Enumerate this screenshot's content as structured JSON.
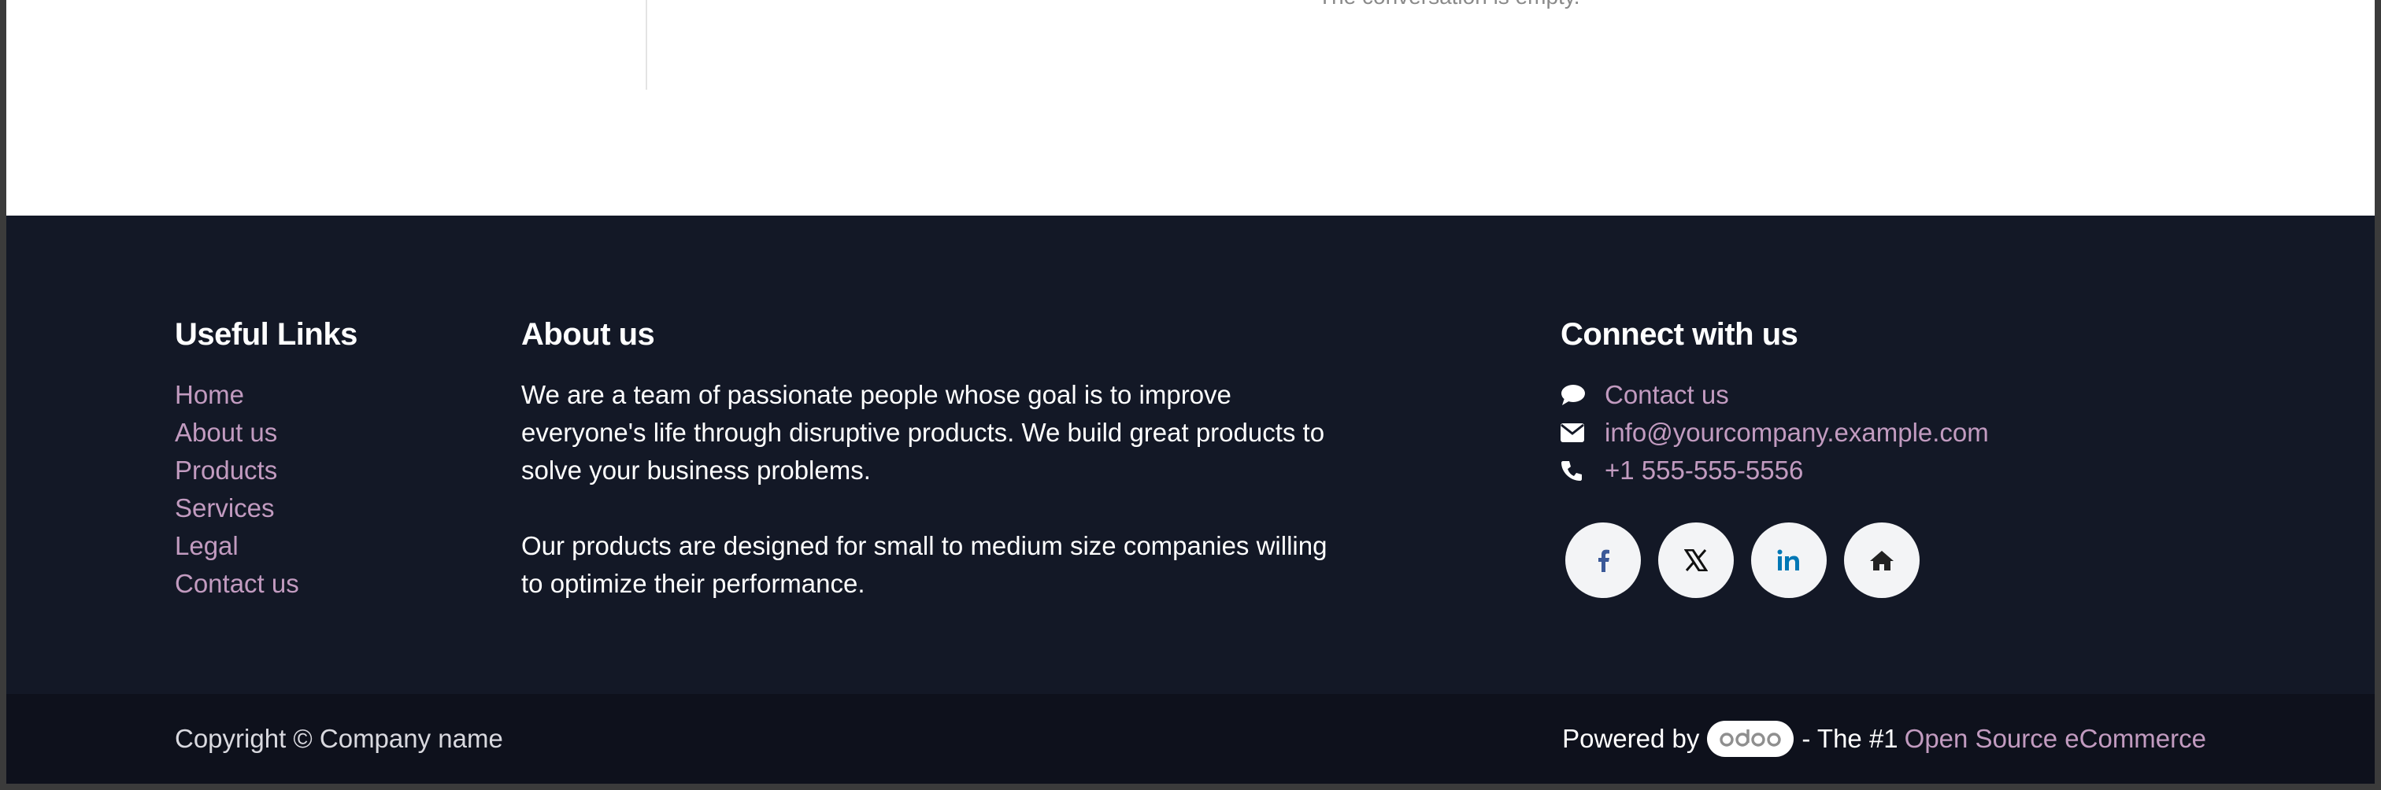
{
  "chat": {
    "empty_message": "The conversation is empty."
  },
  "footer": {
    "useful_links": {
      "title": "Useful Links",
      "items": [
        "Home",
        "About us",
        "Products",
        "Services",
        "Legal",
        "Contact us"
      ]
    },
    "about": {
      "title": "About us",
      "paragraph1": "We are a team of passionate people whose goal is to improve everyone's life through disruptive products. We build great products to solve your business problems.",
      "paragraph2": "Our products are designed for small to medium size companies willing to optimize their performance."
    },
    "connect": {
      "title": "Connect with us",
      "contact_label": "Contact us",
      "email": "info@yourcompany.example.com",
      "phone": "+1 555-555-5556",
      "icons": [
        "comment-icon",
        "envelope-icon",
        "phone-icon"
      ],
      "socials": [
        "facebook-icon",
        "x-twitter-icon",
        "linkedin-icon",
        "home-icon"
      ]
    },
    "copyright": "Copyright © Company name",
    "powered": {
      "prefix": "Powered by",
      "brand": "odoo",
      "middle": "- The #1",
      "link": "Open Source eCommerce"
    }
  },
  "colors": {
    "footer_bg": "#131826",
    "bottom_bg": "#0e111c",
    "link": "#c29bc0",
    "social_bg": "#f3f4f6",
    "facebook": "#3b5998",
    "linkedin": "#0077b5"
  }
}
